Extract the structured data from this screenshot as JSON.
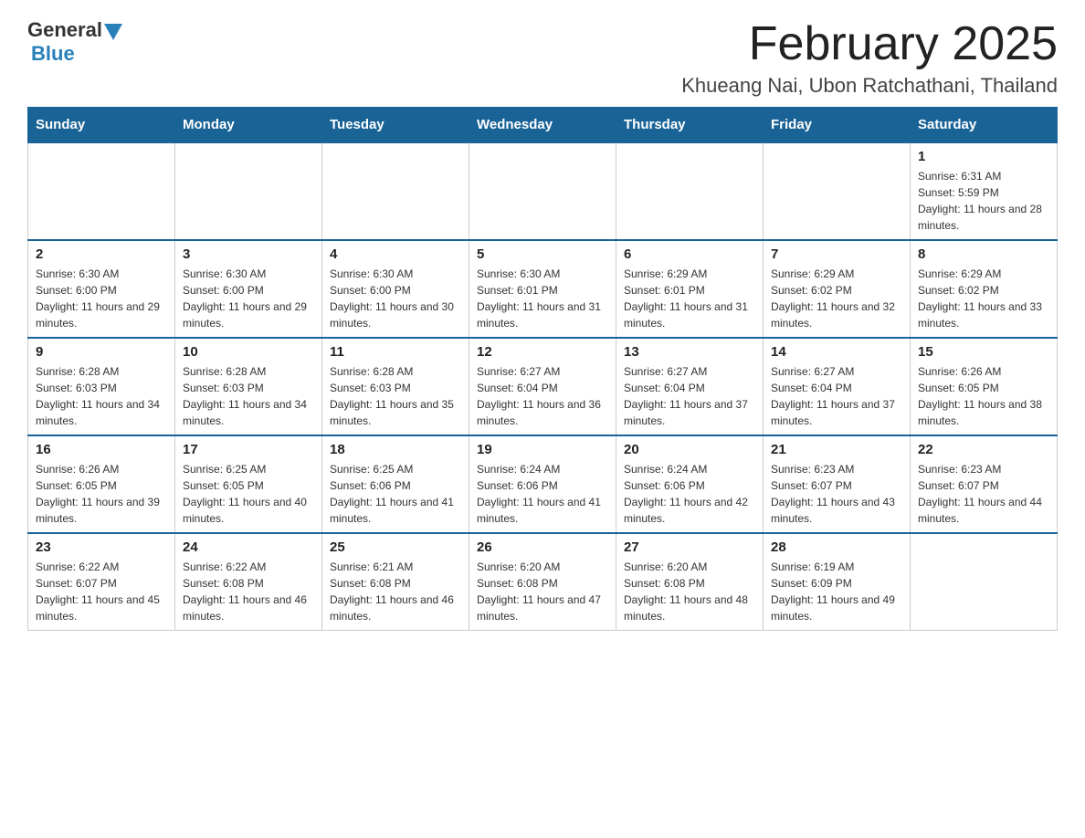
{
  "header": {
    "logo_general": "General",
    "logo_blue": "Blue",
    "month_year": "February 2025",
    "location": "Khueang Nai, Ubon Ratchathani, Thailand"
  },
  "days_of_week": [
    "Sunday",
    "Monday",
    "Tuesday",
    "Wednesday",
    "Thursday",
    "Friday",
    "Saturday"
  ],
  "weeks": [
    [
      {
        "day": "",
        "info": ""
      },
      {
        "day": "",
        "info": ""
      },
      {
        "day": "",
        "info": ""
      },
      {
        "day": "",
        "info": ""
      },
      {
        "day": "",
        "info": ""
      },
      {
        "day": "",
        "info": ""
      },
      {
        "day": "1",
        "info": "Sunrise: 6:31 AM\nSunset: 5:59 PM\nDaylight: 11 hours and 28 minutes."
      }
    ],
    [
      {
        "day": "2",
        "info": "Sunrise: 6:30 AM\nSunset: 6:00 PM\nDaylight: 11 hours and 29 minutes."
      },
      {
        "day": "3",
        "info": "Sunrise: 6:30 AM\nSunset: 6:00 PM\nDaylight: 11 hours and 29 minutes."
      },
      {
        "day": "4",
        "info": "Sunrise: 6:30 AM\nSunset: 6:00 PM\nDaylight: 11 hours and 30 minutes."
      },
      {
        "day": "5",
        "info": "Sunrise: 6:30 AM\nSunset: 6:01 PM\nDaylight: 11 hours and 31 minutes."
      },
      {
        "day": "6",
        "info": "Sunrise: 6:29 AM\nSunset: 6:01 PM\nDaylight: 11 hours and 31 minutes."
      },
      {
        "day": "7",
        "info": "Sunrise: 6:29 AM\nSunset: 6:02 PM\nDaylight: 11 hours and 32 minutes."
      },
      {
        "day": "8",
        "info": "Sunrise: 6:29 AM\nSunset: 6:02 PM\nDaylight: 11 hours and 33 minutes."
      }
    ],
    [
      {
        "day": "9",
        "info": "Sunrise: 6:28 AM\nSunset: 6:03 PM\nDaylight: 11 hours and 34 minutes."
      },
      {
        "day": "10",
        "info": "Sunrise: 6:28 AM\nSunset: 6:03 PM\nDaylight: 11 hours and 34 minutes."
      },
      {
        "day": "11",
        "info": "Sunrise: 6:28 AM\nSunset: 6:03 PM\nDaylight: 11 hours and 35 minutes."
      },
      {
        "day": "12",
        "info": "Sunrise: 6:27 AM\nSunset: 6:04 PM\nDaylight: 11 hours and 36 minutes."
      },
      {
        "day": "13",
        "info": "Sunrise: 6:27 AM\nSunset: 6:04 PM\nDaylight: 11 hours and 37 minutes."
      },
      {
        "day": "14",
        "info": "Sunrise: 6:27 AM\nSunset: 6:04 PM\nDaylight: 11 hours and 37 minutes."
      },
      {
        "day": "15",
        "info": "Sunrise: 6:26 AM\nSunset: 6:05 PM\nDaylight: 11 hours and 38 minutes."
      }
    ],
    [
      {
        "day": "16",
        "info": "Sunrise: 6:26 AM\nSunset: 6:05 PM\nDaylight: 11 hours and 39 minutes."
      },
      {
        "day": "17",
        "info": "Sunrise: 6:25 AM\nSunset: 6:05 PM\nDaylight: 11 hours and 40 minutes."
      },
      {
        "day": "18",
        "info": "Sunrise: 6:25 AM\nSunset: 6:06 PM\nDaylight: 11 hours and 41 minutes."
      },
      {
        "day": "19",
        "info": "Sunrise: 6:24 AM\nSunset: 6:06 PM\nDaylight: 11 hours and 41 minutes."
      },
      {
        "day": "20",
        "info": "Sunrise: 6:24 AM\nSunset: 6:06 PM\nDaylight: 11 hours and 42 minutes."
      },
      {
        "day": "21",
        "info": "Sunrise: 6:23 AM\nSunset: 6:07 PM\nDaylight: 11 hours and 43 minutes."
      },
      {
        "day": "22",
        "info": "Sunrise: 6:23 AM\nSunset: 6:07 PM\nDaylight: 11 hours and 44 minutes."
      }
    ],
    [
      {
        "day": "23",
        "info": "Sunrise: 6:22 AM\nSunset: 6:07 PM\nDaylight: 11 hours and 45 minutes."
      },
      {
        "day": "24",
        "info": "Sunrise: 6:22 AM\nSunset: 6:08 PM\nDaylight: 11 hours and 46 minutes."
      },
      {
        "day": "25",
        "info": "Sunrise: 6:21 AM\nSunset: 6:08 PM\nDaylight: 11 hours and 46 minutes."
      },
      {
        "day": "26",
        "info": "Sunrise: 6:20 AM\nSunset: 6:08 PM\nDaylight: 11 hours and 47 minutes."
      },
      {
        "day": "27",
        "info": "Sunrise: 6:20 AM\nSunset: 6:08 PM\nDaylight: 11 hours and 48 minutes."
      },
      {
        "day": "28",
        "info": "Sunrise: 6:19 AM\nSunset: 6:09 PM\nDaylight: 11 hours and 49 minutes."
      },
      {
        "day": "",
        "info": ""
      }
    ]
  ]
}
